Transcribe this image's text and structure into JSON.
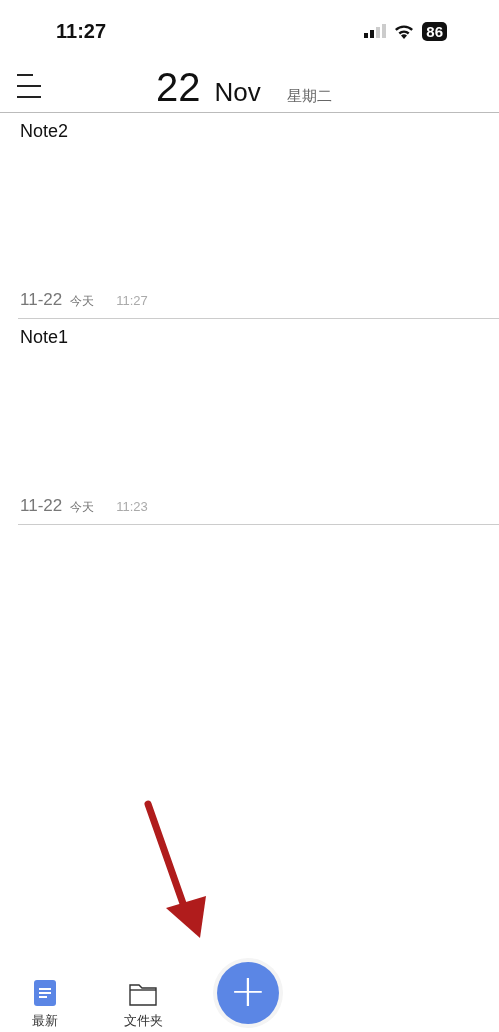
{
  "status_bar": {
    "time": "11:27",
    "battery": "86"
  },
  "header": {
    "day": "22",
    "month": "Nov",
    "weekday": "星期二"
  },
  "notes": [
    {
      "title": "Note2",
      "date": "11-22",
      "day_label": "今天",
      "time": "11:27"
    },
    {
      "title": "Note1",
      "date": "11-22",
      "day_label": "今天",
      "time": "11:23"
    }
  ],
  "tab_bar": {
    "tabs": [
      {
        "label": "最新",
        "kind": "recent",
        "selected": true
      },
      {
        "label": "文件夹",
        "kind": "folder",
        "selected": false
      }
    ],
    "add_button": "+"
  }
}
